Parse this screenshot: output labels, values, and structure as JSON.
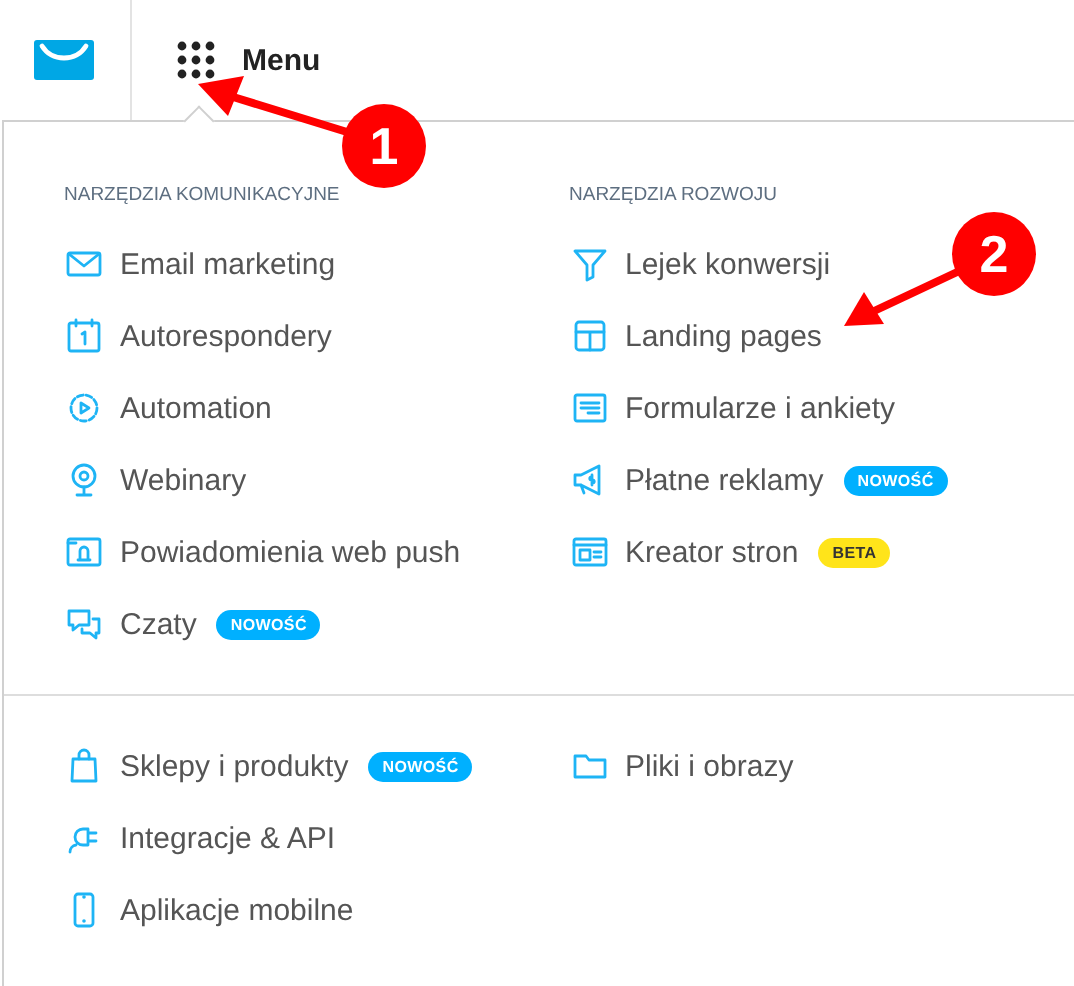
{
  "header": {
    "menu_label": "Menu"
  },
  "sections": [
    {
      "columns": [
        {
          "heading": "NARZĘDZIA KOMUNIKACYJNE",
          "items": [
            {
              "label": "Email marketing"
            },
            {
              "label": "Autorespondery"
            },
            {
              "label": "Automation"
            },
            {
              "label": "Webinary"
            },
            {
              "label": "Powiadomienia web push"
            },
            {
              "label": "Czaty",
              "badge": {
                "text": "NOWOŚĆ",
                "kind": "new"
              }
            }
          ]
        },
        {
          "heading": "NARZĘDZIA ROZWOJU",
          "items": [
            {
              "label": "Lejek konwersji"
            },
            {
              "label": "Landing pages"
            },
            {
              "label": "Formularze i ankiety"
            },
            {
              "label": "Płatne reklamy",
              "badge": {
                "text": "NOWOŚĆ",
                "kind": "new"
              }
            },
            {
              "label": "Kreator stron",
              "badge": {
                "text": "BETA",
                "kind": "beta"
              }
            }
          ]
        }
      ]
    },
    {
      "columns": [
        {
          "items": [
            {
              "label": "Sklepy i produkty",
              "badge": {
                "text": "NOWOŚĆ",
                "kind": "new"
              }
            },
            {
              "label": "Integracje & API"
            },
            {
              "label": "Aplikacje mobilne"
            }
          ]
        },
        {
          "items": [
            {
              "label": "Pliki i obrazy"
            }
          ]
        }
      ]
    }
  ],
  "annotations": [
    {
      "label": "1"
    },
    {
      "label": "2"
    }
  ]
}
